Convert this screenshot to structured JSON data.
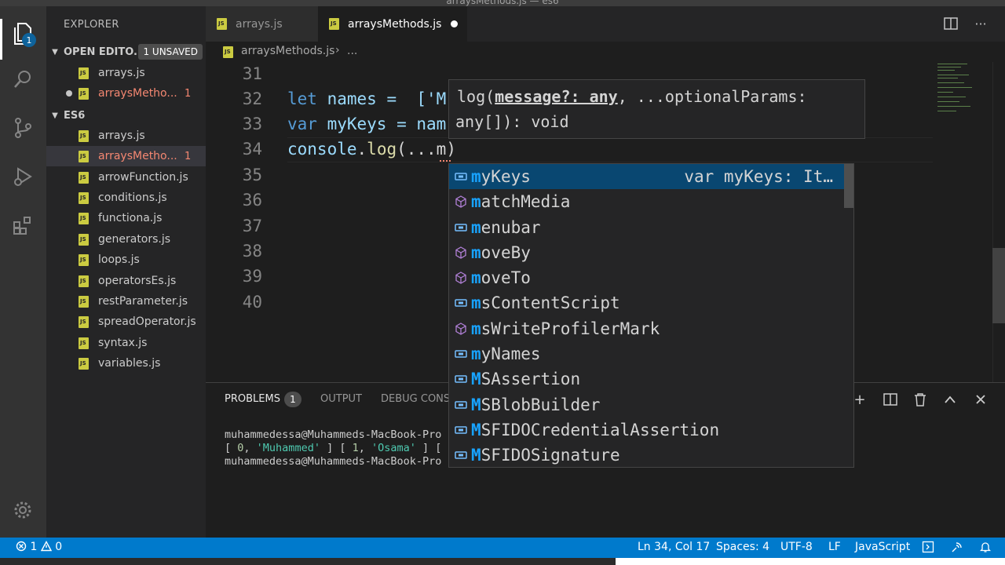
{
  "window": {
    "title": "arraysMethods.js — es6"
  },
  "activity_bar": {
    "explorer_badge": "1"
  },
  "sidebar": {
    "title": "EXPLORER",
    "open_editors": {
      "label": "OPEN EDITO...",
      "badge": "1 UNSAVED",
      "items": [
        {
          "name": "arrays.js",
          "count": ""
        },
        {
          "name": "arraysMetho...",
          "count": "1"
        }
      ]
    },
    "folder": {
      "label": "ES6",
      "items": [
        {
          "name": "arrays.js",
          "count": ""
        },
        {
          "name": "arraysMetho...",
          "count": "1"
        },
        {
          "name": "arrowFunction.js",
          "count": ""
        },
        {
          "name": "conditions.js",
          "count": ""
        },
        {
          "name": "functiona.js",
          "count": ""
        },
        {
          "name": "generators.js",
          "count": ""
        },
        {
          "name": "loops.js",
          "count": ""
        },
        {
          "name": "operatorsEs.js",
          "count": ""
        },
        {
          "name": "restParameter.js",
          "count": ""
        },
        {
          "name": "spreadOperator.js",
          "count": ""
        },
        {
          "name": "syntax.js",
          "count": ""
        },
        {
          "name": "variables.js",
          "count": ""
        }
      ]
    }
  },
  "tabs": [
    {
      "label": "arrays.js"
    },
    {
      "label": "arraysMethods.js"
    }
  ],
  "breadcrumb": {
    "file": "arraysMethods.js",
    "separator": "›",
    "more": "..."
  },
  "editor": {
    "line_numbers": [
      "31",
      "32",
      "33",
      "34",
      "35",
      "36",
      "37",
      "38",
      "39",
      "40"
    ],
    "line32": {
      "kw": "let",
      "rest": " names =  ['M"
    },
    "line33": {
      "kw": "var",
      "rest": " myKeys = nam"
    },
    "line34": {
      "obj": "console",
      "dot": ".",
      "fn": "log",
      "rest": "(...m)"
    }
  },
  "hover": {
    "line1_fn": "log(",
    "line1_param": "message?: any",
    "line1_rest": ", ...optionalParams:",
    "line2": "any[]): void"
  },
  "suggestions": [
    {
      "match": "m",
      "rest": "yKeys",
      "detail": "var myKeys: It…",
      "kind": "variable"
    },
    {
      "match": "m",
      "rest": "atchMedia",
      "detail": "",
      "kind": "method"
    },
    {
      "match": "m",
      "rest": "enubar",
      "detail": "",
      "kind": "variable"
    },
    {
      "match": "m",
      "rest": "oveBy",
      "detail": "",
      "kind": "method"
    },
    {
      "match": "m",
      "rest": "oveTo",
      "detail": "",
      "kind": "method"
    },
    {
      "match": "m",
      "rest": "sContentScript",
      "detail": "",
      "kind": "variable"
    },
    {
      "match": "m",
      "rest": "sWriteProfilerMark",
      "detail": "",
      "kind": "method"
    },
    {
      "match": "m",
      "rest": "yNames",
      "detail": "",
      "kind": "variable"
    },
    {
      "match": "M",
      "rest": "SAssertion",
      "detail": "",
      "kind": "variable"
    },
    {
      "match": "M",
      "rest": "SBlobBuilder",
      "detail": "",
      "kind": "variable"
    },
    {
      "match": "M",
      "rest": "SFIDOCredentialAssertion",
      "detail": "",
      "kind": "variable"
    },
    {
      "match": "M",
      "rest": "SFIDOSignature",
      "detail": "",
      "kind": "variable"
    }
  ],
  "panel": {
    "tabs": {
      "problems": "PROBLEMS",
      "problems_count": "1",
      "output": "OUTPUT",
      "debug": "DEBUG CONSO"
    },
    "terminal": {
      "line1": "muhammedessa@Muhammeds-MacBook-Pro",
      "line2_a": "[ ",
      "line2_n0": "0",
      "line2_b": ", ",
      "line2_s0": "'Muhammed'",
      "line2_c": " ] [ ",
      "line2_n1": "1",
      "line2_d": ", ",
      "line2_s1": "'Osama'",
      "line2_e": " ] [",
      "line3": "muhammedessa@Muhammeds-MacBook-Pro"
    }
  },
  "status": {
    "errors": "1",
    "warnings": "0",
    "position": "Ln 34, Col 17",
    "spaces": "Spaces: 4",
    "encoding": "UTF-8",
    "eol": "LF",
    "language": "JavaScript"
  },
  "colors": {
    "accent": "#007acc",
    "selection": "#094771",
    "error": "#f48771",
    "js_icon": "#cbcb41"
  }
}
